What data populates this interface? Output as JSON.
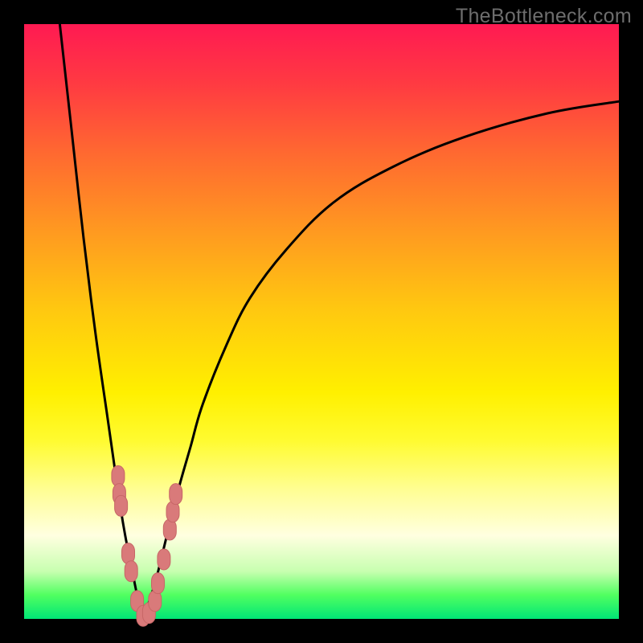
{
  "watermark": "TheBottleneck.com",
  "colors": {
    "frame": "#000000",
    "curve": "#000000",
    "marker_fill": "#d97a7a",
    "marker_stroke": "#c76666",
    "gradient_stops": [
      "#ff1a52",
      "#ff3a42",
      "#ff6a30",
      "#ff9a20",
      "#ffc810",
      "#fff000",
      "#fffb30",
      "#fffe90",
      "#ffffe0",
      "#c8ffb0",
      "#50ff60",
      "#00e676"
    ]
  },
  "chart_data": {
    "type": "line",
    "title": "",
    "xlabel": "",
    "ylabel": "",
    "xlim": [
      0,
      100
    ],
    "ylim": [
      0,
      100
    ],
    "note": "V-shaped bottleneck curve. Y is mismatch percentage (100 at top, 0 at bottom). One left descending branch and one right ascending branch meeting near x≈20, y≈0.",
    "series": [
      {
        "name": "left-branch",
        "x": [
          6,
          8,
          10,
          12,
          14,
          15,
          16,
          17,
          18,
          19,
          20
        ],
        "values": [
          100,
          82,
          64,
          48,
          34,
          27,
          20,
          14,
          9,
          4,
          0
        ]
      },
      {
        "name": "right-branch",
        "x": [
          20,
          22,
          24,
          26,
          28,
          30,
          34,
          38,
          44,
          52,
          62,
          74,
          88,
          100
        ],
        "values": [
          0,
          6,
          14,
          22,
          29,
          36,
          46,
          54,
          62,
          70,
          76,
          81,
          85,
          87
        ]
      }
    ],
    "markers": {
      "name": "highlight-points",
      "shape": "rounded-capsule",
      "x": [
        15.8,
        16.0,
        16.3,
        17.5,
        18.0,
        19.0,
        20.0,
        21.0,
        22.0,
        22.5,
        23.5,
        24.5,
        25.0,
        25.5
      ],
      "values": [
        24,
        21,
        19,
        11,
        8,
        3,
        0.5,
        1,
        3,
        6,
        10,
        15,
        18,
        21
      ]
    }
  }
}
